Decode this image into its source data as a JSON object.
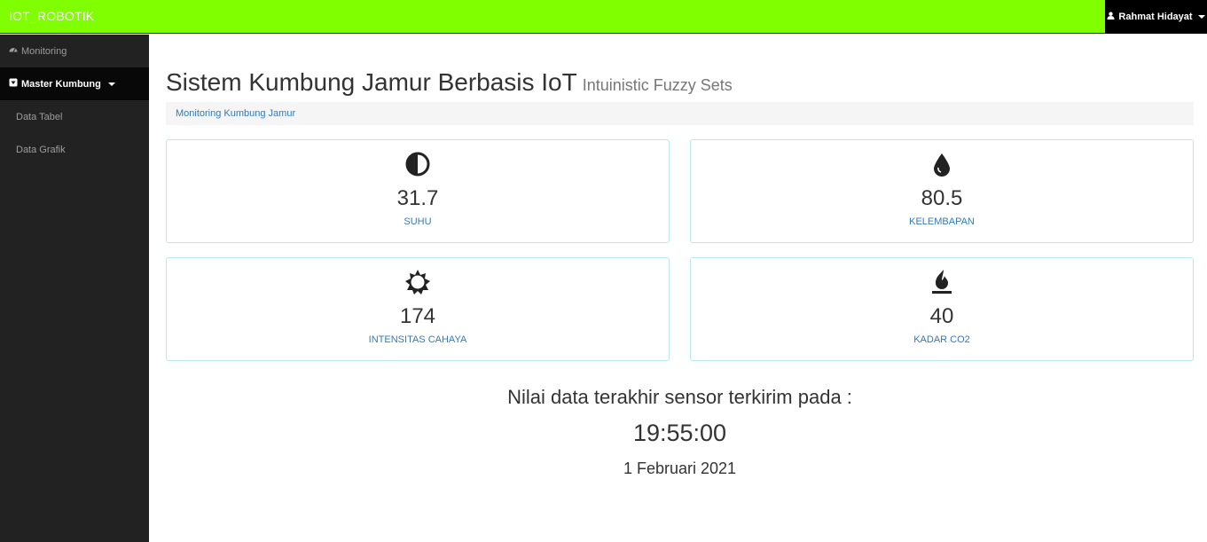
{
  "navbar": {
    "brand": "IOT_ROBOTIK",
    "user_name": "Rahmat Hidayat",
    "user_icon": "user-icon"
  },
  "sidebar": {
    "monitoring": {
      "label": "Monitoring",
      "icon": "dashboard-icon"
    },
    "master": {
      "label": "Master Kumbung",
      "icon": "caret-square-down-icon"
    },
    "sub_items": [
      {
        "label": "Data Tabel"
      },
      {
        "label": "Data Grafik"
      }
    ]
  },
  "header": {
    "title": "Sistem Kumbung Jamur Berbasis IoT",
    "subtitle": "Intuinistic Fuzzy Sets"
  },
  "breadcrumb": {
    "item": "Monitoring Kumbung Jamur"
  },
  "panels": [
    {
      "icon": "adjust-icon",
      "value": "31.7",
      "label": "SUHU"
    },
    {
      "icon": "tint-icon",
      "value": "80.5",
      "label": "KELEMBAPAN"
    },
    {
      "icon": "sun-icon",
      "value": "174",
      "label": "INTENSITAS CAHAYA"
    },
    {
      "icon": "fire-icon",
      "value": "40",
      "label": "KADAR CO2"
    }
  ],
  "last_update": {
    "heading": "Nilai data terakhir sensor terkirim pada :",
    "time": "19:55:00",
    "date": "1 Februari 2021"
  },
  "colors": {
    "navbar": "#7fff00",
    "sidebar": "#222222",
    "link": "#337ab7",
    "panel_border": "#bce8f1"
  }
}
